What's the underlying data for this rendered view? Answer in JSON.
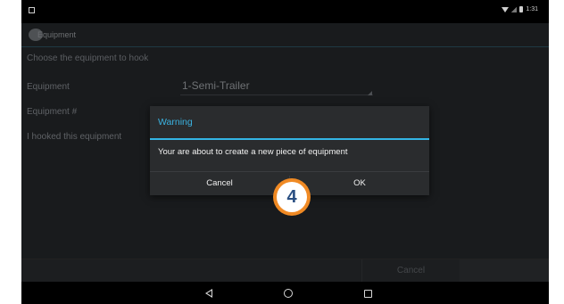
{
  "status_bar": {
    "time": "1:31"
  },
  "action_bar": {
    "title": "Equipment"
  },
  "form": {
    "subtitle": "Choose the equipment to hook",
    "equipment_label": "Equipment",
    "equipment_value": "1-Semi-Trailer",
    "equipment_num_label": "Equipment #",
    "hooked_label": "I hooked this equipment"
  },
  "bottom_bar": {
    "cancel_label": "Cancel"
  },
  "dialog": {
    "title": "Warning",
    "message": "Your are about to create a new piece of equipment",
    "cancel_label": "Cancel",
    "ok_label": "OK"
  },
  "step_badge": {
    "number": "4"
  },
  "colors": {
    "accent": "#33b5e5",
    "badge": "#f08a24",
    "badge_number": "#2a4f82"
  }
}
